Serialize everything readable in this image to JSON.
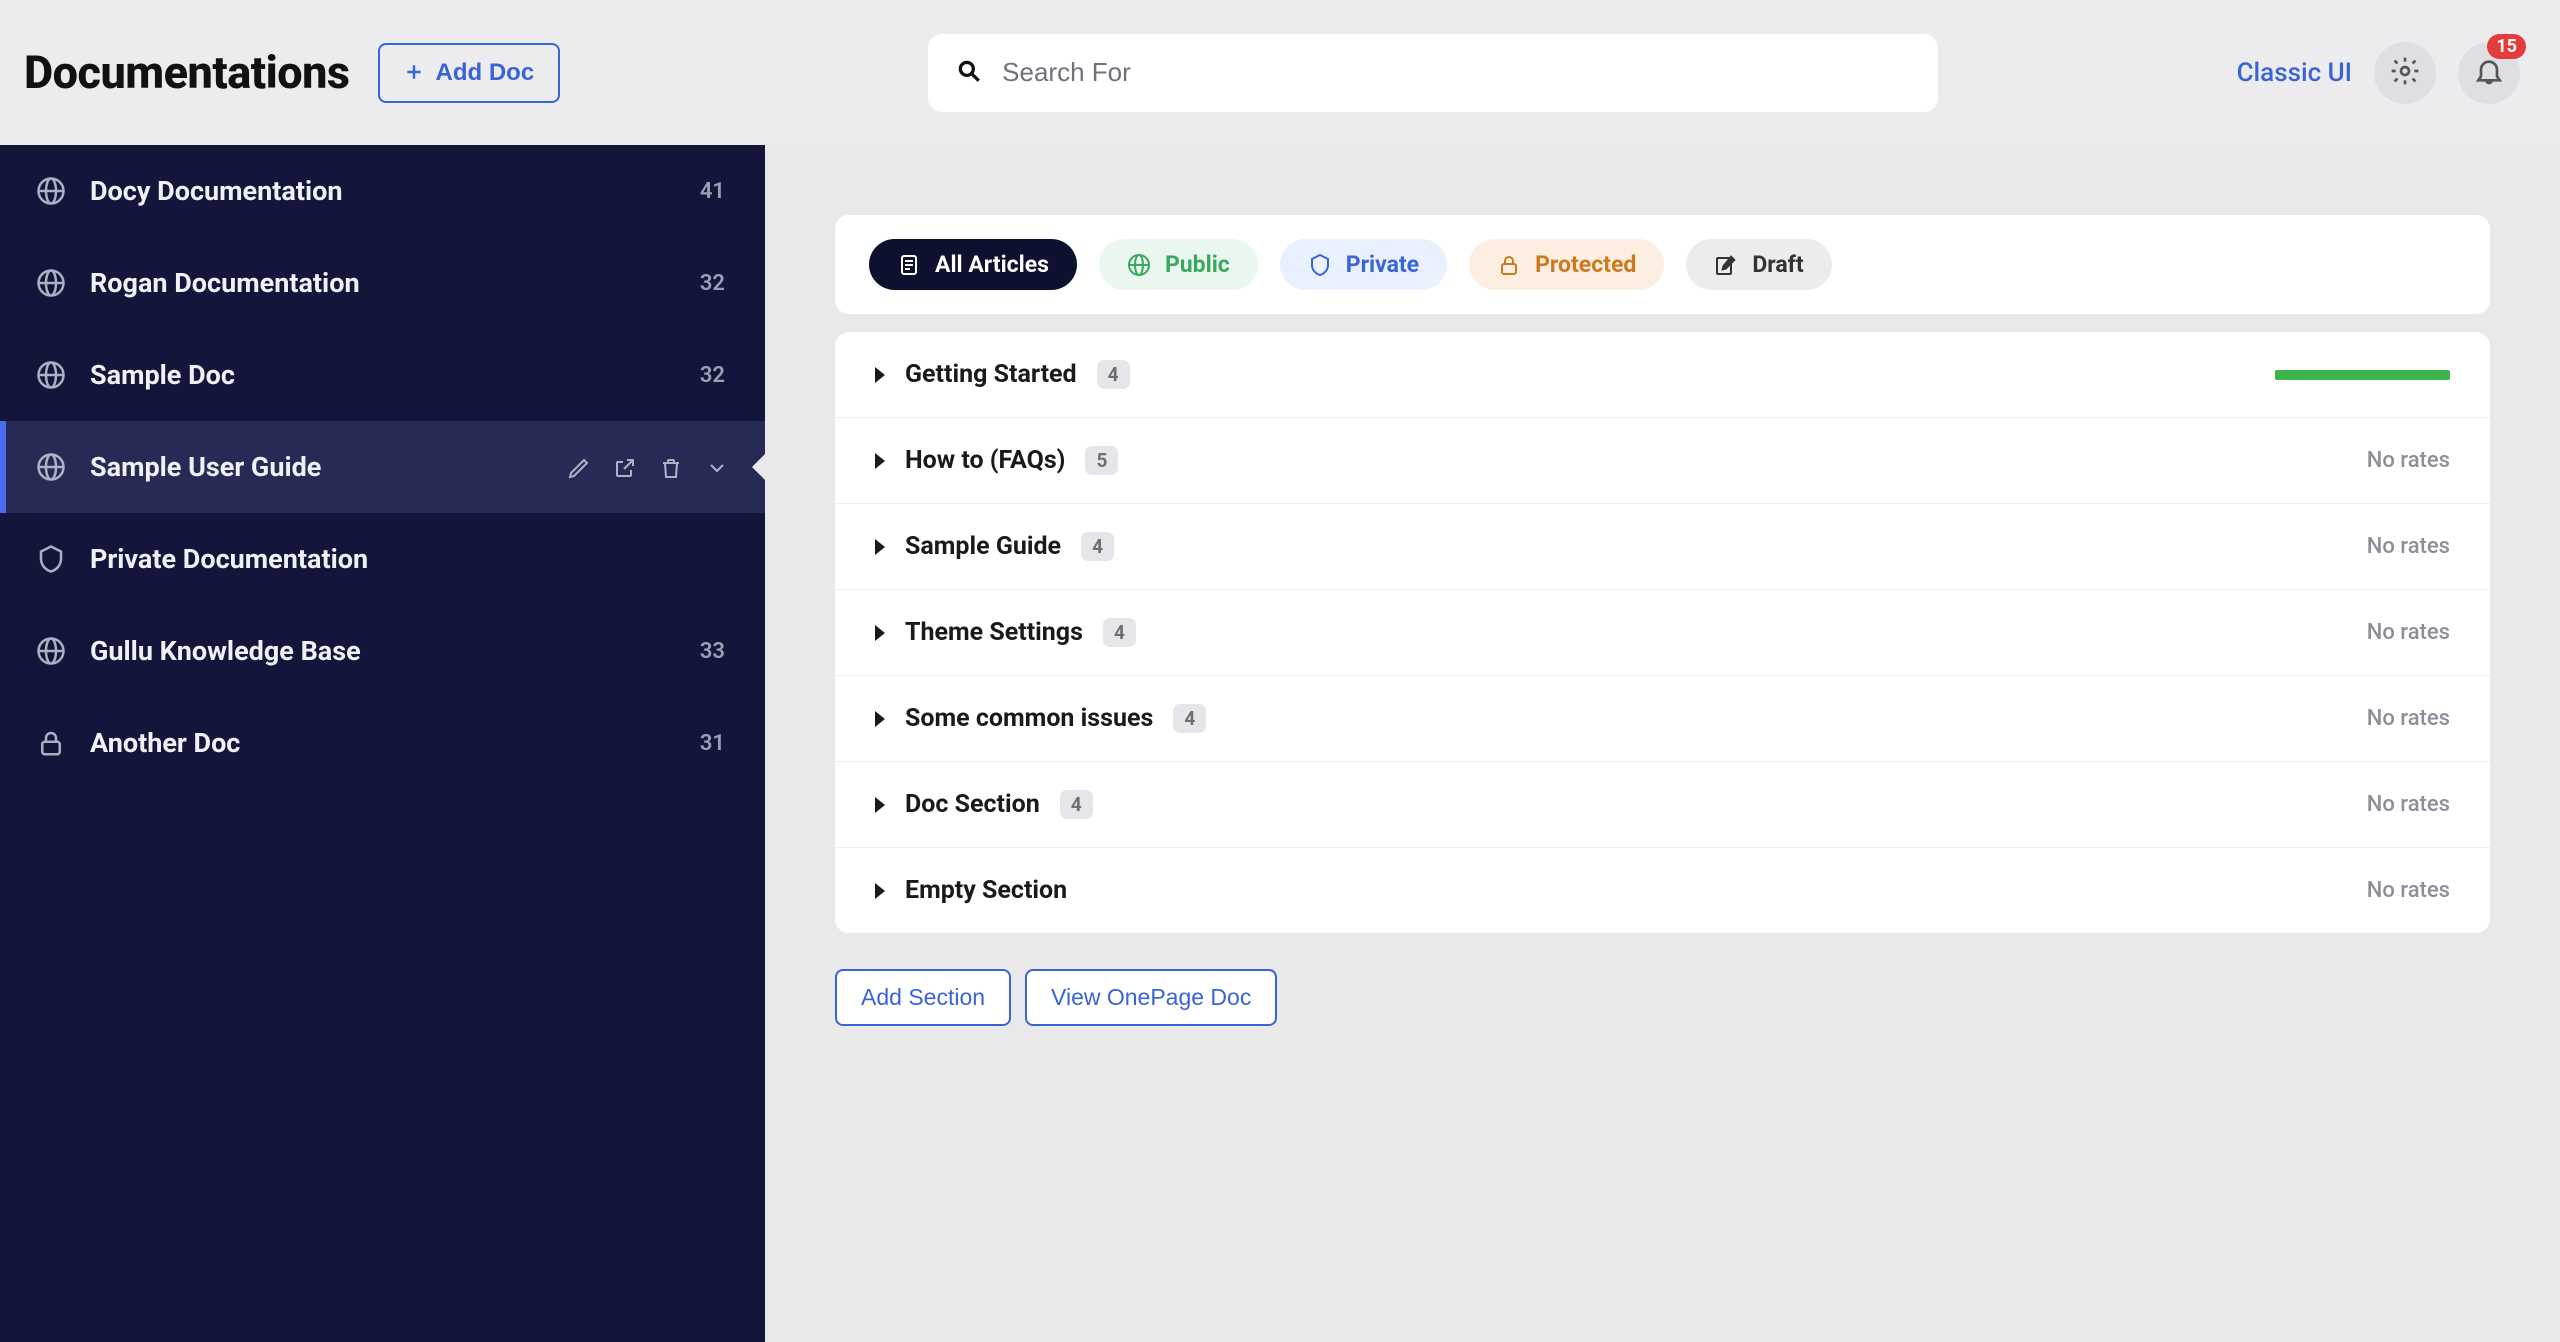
{
  "header": {
    "title": "Documentations",
    "add_doc_label": "Add Doc"
  },
  "search": {
    "placeholder": "Search For"
  },
  "topright": {
    "classic_ui_label": "Classic UI",
    "notification_count": "15"
  },
  "sidebar": {
    "items": [
      {
        "icon": "globe",
        "label": "Docy Documentation",
        "count": "41",
        "active": false
      },
      {
        "icon": "globe",
        "label": "Rogan Documentation",
        "count": "32",
        "active": false
      },
      {
        "icon": "globe",
        "label": "Sample Doc",
        "count": "32",
        "active": false
      },
      {
        "icon": "globe",
        "label": "Sample User Guide",
        "count": "",
        "active": true
      },
      {
        "icon": "shield",
        "label": "Private Documentation",
        "count": "",
        "active": false
      },
      {
        "icon": "globe",
        "label": "Gullu Knowledge Base",
        "count": "33",
        "active": false
      },
      {
        "icon": "lock",
        "label": "Another Doc",
        "count": "31",
        "active": false
      }
    ]
  },
  "filters": [
    {
      "kind": "all",
      "label": "All Articles",
      "icon": "doc"
    },
    {
      "kind": "public",
      "label": "Public",
      "icon": "globe"
    },
    {
      "kind": "private",
      "label": "Private",
      "icon": "shield"
    },
    {
      "kind": "protected",
      "label": "Protected",
      "icon": "lock"
    },
    {
      "kind": "draft",
      "label": "Draft",
      "icon": "pencil-square"
    }
  ],
  "sections": [
    {
      "title": "Getting Started",
      "count": "4",
      "rates": "bar"
    },
    {
      "title": "How to (FAQs)",
      "count": "5",
      "rates": "No rates"
    },
    {
      "title": "Sample Guide",
      "count": "4",
      "rates": "No rates"
    },
    {
      "title": "Theme Settings",
      "count": "4",
      "rates": "No rates"
    },
    {
      "title": "Some common issues",
      "count": "4",
      "rates": "No rates"
    },
    {
      "title": "Doc Section",
      "count": "4",
      "rates": "No rates"
    },
    {
      "title": "Empty Section",
      "count": "",
      "rates": "No rates"
    }
  ],
  "actions": {
    "add_section_label": "Add Section",
    "view_onepage_label": "View OnePage Doc"
  }
}
